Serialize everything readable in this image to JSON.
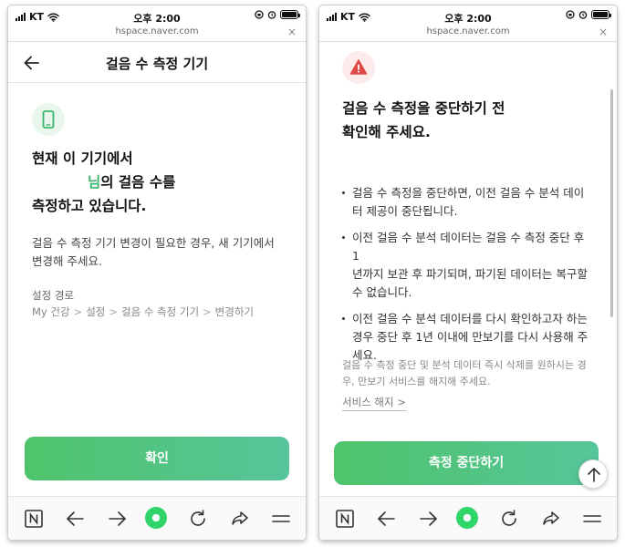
{
  "status_bar": {
    "carrier": "KT",
    "time": "오후 2:00"
  },
  "url_bar": {
    "domain": "hspace.naver.com",
    "close_label": "×"
  },
  "left_screen": {
    "title": "걸음 수 측정 기기",
    "heading_line1": "현재 이 기기에서",
    "heading_name_suffix": "님",
    "heading_line2_rest": "의 걸음 수를",
    "heading_line3": "측정하고 있습니다.",
    "description_line1": "걸음 수 측정 기기 변경이 필요한 경우, 새 기기에서",
    "description_line2": "변경해 주세요.",
    "path_label": "설정 경로",
    "breadcrumb": [
      "My 건강",
      "설정",
      "걸음 수 측정 기기",
      "변경하기"
    ],
    "breadcrumb_sep": ">",
    "confirm_button": "확인"
  },
  "right_screen": {
    "heading_line1": "걸음 수 측정을 중단하기 전",
    "heading_line2": "확인해 주세요.",
    "bullets": [
      {
        "l1": "걸음 수 측정을 중단하면, 이전 걸음 수 분석 데이",
        "l2": "터 제공이 중단됩니다.",
        "l3": ""
      },
      {
        "l1": "이전 걸음 수 분석 데이터는 걸음 수 측정 중단 후 1",
        "l2": "년까지 보관 후 파기되며, 파기된 데이터는 복구할",
        "l3": "수 없습니다."
      },
      {
        "l1": "이전 걸음 수 분석 데이터를 다시 확인하고자 하는",
        "l2": "경우 중단 후 1년 이내에 만보기를 다시 사용해 주",
        "l3": "세요."
      }
    ],
    "note_line1": "걸음 수 측정 중단 및 분석 데이터 즉시 삭제를 원하시는 경",
    "note_line2": "우, 만보기 서비스를 해지해 주세요.",
    "unsubscribe_link": "서비스 해지 >",
    "stop_button": "측정 중단하기"
  },
  "colors": {
    "accent_green": "#3bb56b",
    "button_gradient_start": "#4ec46a",
    "button_gradient_end": "#56c59a",
    "warning_red": "#e04848"
  },
  "icons": {
    "phone": "smartphone-icon",
    "warning": "warning-triangle-icon",
    "back": "arrow-left-icon"
  }
}
